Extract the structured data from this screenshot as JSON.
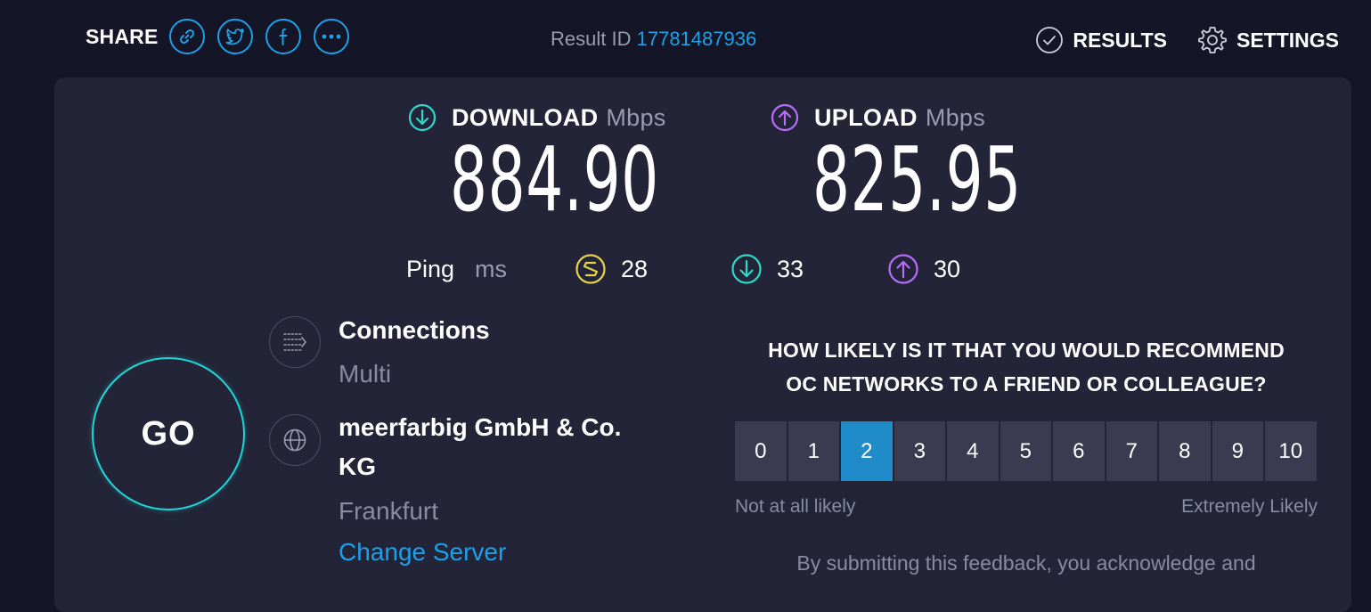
{
  "share": {
    "label": "SHARE",
    "icons": [
      "link-icon",
      "twitter-icon",
      "facebook-icon",
      "more-icon"
    ]
  },
  "result": {
    "label": "Result ID",
    "id": "17781487936"
  },
  "nav": {
    "results": "RESULTS",
    "settings": "SETTINGS"
  },
  "download": {
    "label": "DOWNLOAD",
    "unit": "Mbps",
    "value": "884.90",
    "color": "#2fd8c8"
  },
  "upload": {
    "label": "UPLOAD",
    "unit": "Mbps",
    "value": "825.95",
    "color": "#b76dfa"
  },
  "ping": {
    "label": "Ping",
    "unit": "ms",
    "idle": "28",
    "download": "33",
    "upload": "30",
    "idle_color": "#e8d44c"
  },
  "go": {
    "label": "GO",
    "color": "#1fd6d6"
  },
  "connections": {
    "title": "Connections",
    "value": "Multi"
  },
  "server": {
    "name_line1": "meerfarbig GmbH & Co.",
    "name_line2": "KG",
    "location": "Frankfurt",
    "change": "Change Server"
  },
  "survey": {
    "question_line1": "HOW LIKELY IS IT THAT YOU WOULD RECOMMEND",
    "question_line2": "OC NETWORKS TO A FRIEND OR COLLEAGUE?",
    "scale": [
      "0",
      "1",
      "2",
      "3",
      "4",
      "5",
      "6",
      "7",
      "8",
      "9",
      "10"
    ],
    "selected": "2",
    "low_label": "Not at all likely",
    "high_label": "Extremely Likely",
    "disclaimer": "By submitting this feedback, you acknowledge and"
  }
}
